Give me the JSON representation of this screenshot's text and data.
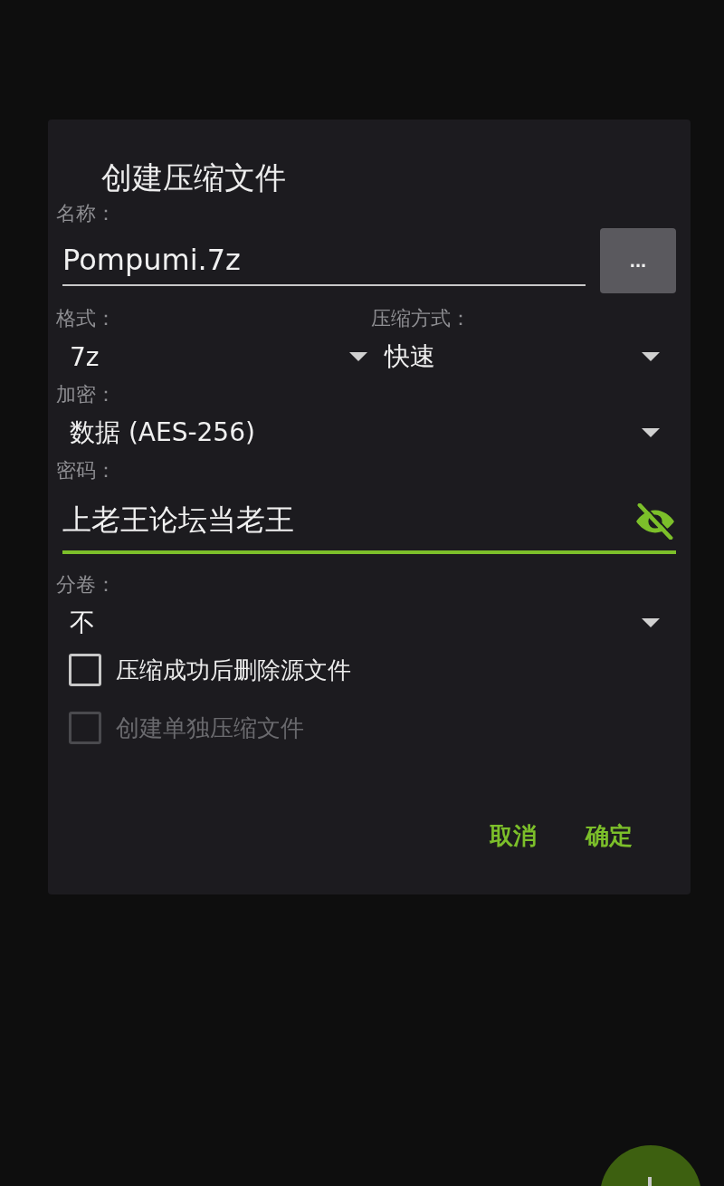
{
  "dialog": {
    "title": "创建压缩文件",
    "name": {
      "label": "名称：",
      "value": "Pompumi.7z",
      "browse_button": "..."
    },
    "format": {
      "label": "格式：",
      "value": "7z"
    },
    "method": {
      "label": "压缩方式：",
      "value": "快速"
    },
    "encryption": {
      "label": "加密：",
      "value": "数据 (AES-256)"
    },
    "password": {
      "label": "密码：",
      "value": "上老王论坛当老王",
      "focused": true
    },
    "split": {
      "label": "分卷：",
      "value": "不"
    },
    "options": [
      {
        "label": "压缩成功后删除源文件",
        "checked": false,
        "disabled": false
      },
      {
        "label": "创建单独压缩文件",
        "checked": false,
        "disabled": true
      }
    ],
    "buttons": [
      "取消",
      "确定"
    ]
  }
}
